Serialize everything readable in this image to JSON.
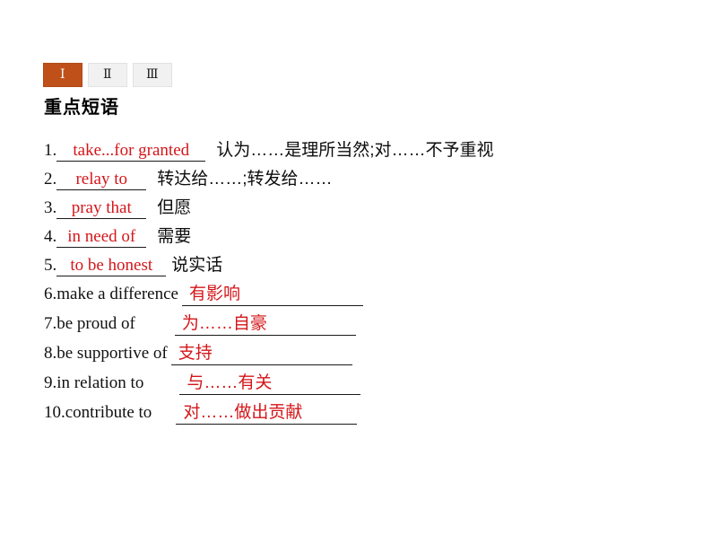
{
  "tabs": [
    {
      "label": "Ⅰ",
      "active": true
    },
    {
      "label": "Ⅱ",
      "active": false
    },
    {
      "label": "Ⅲ",
      "active": false
    }
  ],
  "section": {
    "heading": "重点短语"
  },
  "phrases": {
    "answer_color": "#d4161a",
    "accent_color": "#c0501a",
    "items": [
      {
        "num": "1.",
        "answer": "take...for granted",
        "printed": "认为……是理所当然;对……不予重视",
        "answer_side": "left"
      },
      {
        "num": "2.",
        "answer": "relay to",
        "printed": "转达给……;转发给……",
        "answer_side": "left"
      },
      {
        "num": "3.",
        "answer": "pray that",
        "printed": "但愿",
        "answer_side": "left"
      },
      {
        "num": "4.",
        "answer": "in need of",
        "printed": "需要",
        "answer_side": "left"
      },
      {
        "num": "5.",
        "answer": "to be honest",
        "printed": "说实话",
        "answer_side": "left"
      },
      {
        "num": "6.",
        "printed": "make a difference",
        "answer": "有影响",
        "answer_side": "right"
      },
      {
        "num": "7.",
        "printed": "be proud of",
        "answer": "为……自豪",
        "answer_side": "right"
      },
      {
        "num": "8.",
        "printed": "be supportive of",
        "answer": "支持",
        "answer_side": "right"
      },
      {
        "num": "9.",
        "printed": "in relation to",
        "answer": "与……有关",
        "answer_side": "right"
      },
      {
        "num": "10.",
        "printed": "contribute to",
        "answer": "对……做出贡献",
        "answer_side": "right"
      }
    ]
  }
}
